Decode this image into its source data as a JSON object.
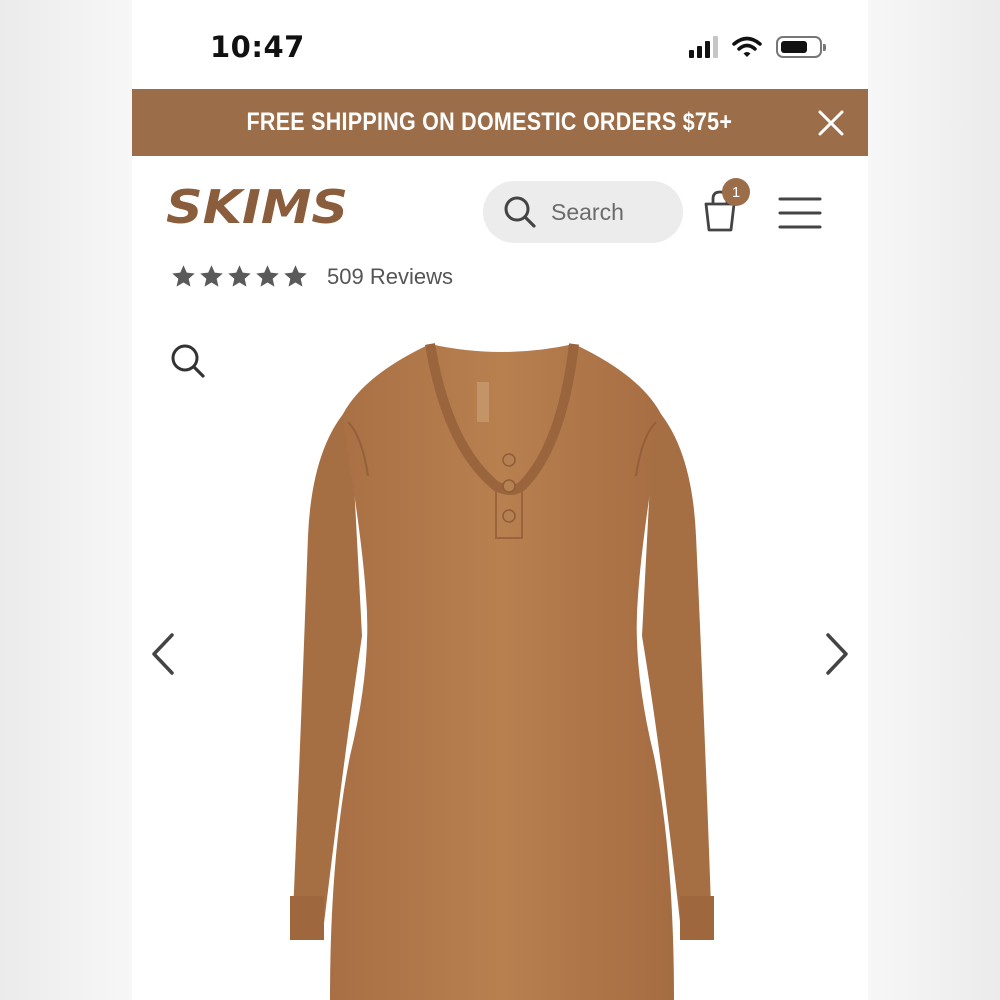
{
  "status_bar": {
    "time": "10:47"
  },
  "promo_banner": {
    "text": "FREE SHIPPING ON DOMESTIC ORDERS $75+",
    "color": "#9b6d49"
  },
  "header": {
    "logo_text": "SKIMS",
    "search_label": "Search",
    "cart_count": "1",
    "icons": [
      "search-icon",
      "shopping-bag-icon",
      "hamburger-menu-icon"
    ]
  },
  "reviews": {
    "rating_stars": 5,
    "count_label": "509 Reviews"
  },
  "product_gallery": {
    "icons": [
      "zoom-icon",
      "chevron-left-icon",
      "chevron-right-icon"
    ],
    "product_color": "#b27a4c"
  }
}
